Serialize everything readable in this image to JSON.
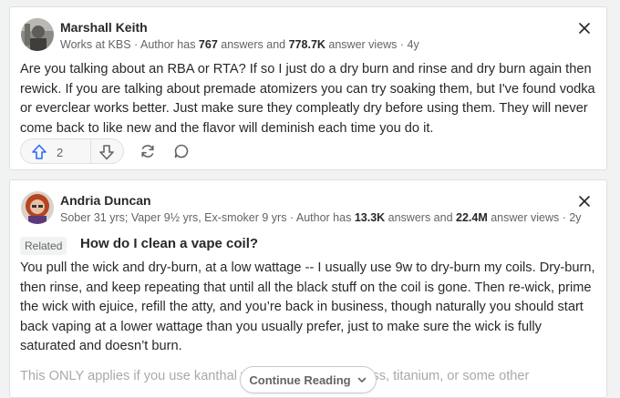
{
  "answer1": {
    "author": "Marshall Keith",
    "meta_prefix": "Works at KBS · Author has ",
    "answers_count": "767",
    "meta_mid": " answers and ",
    "views_count": "778.7K",
    "meta_suffix": " answer views · 4y",
    "body": "Are you talking about an RBA or RTA? If so I just do a dry burn and rinse and dry burn again then rewick. If you are talking about premade atomizers you can try soaking them, but I've found vodka or everclear works better. Just make sure they compleatly dry before using them. They will never come back to like new and the flavor will deminish each time you do it.",
    "upvotes": "2"
  },
  "answer2": {
    "author": "Andria Duncan",
    "meta_prefix": "Sober 31 yrs; Vaper 9½ yrs, Ex-smoker 9 yrs · Author has ",
    "answers_count": "13.3K",
    "meta_mid": " answers and ",
    "views_count": "22.4M",
    "meta_suffix": " answer views · 2y",
    "related_label": "Related",
    "related_question": "How do I clean a vape coil?",
    "body": "You pull the wick and dry-burn, at a low wattage -- I usually use 9w to dry-burn my coils. Dry-burn, then rinse, and keep repeating that until all the black stuff on the coil is gone. Then re-wick, prime the wick with ejuice, refill the atty, and you’re back in business, though naturally you should start back vaping at a lower wattage than you usually prefer, just to make sure the wick is fully saturated and doesn’t burn.",
    "faded_text": "This ONLY applies if you use kanthal wire. If you use stainless, titanium, or some other",
    "continue_label": "Continue Reading"
  },
  "colors": {
    "accent_blue": "#2e69ff",
    "icon_gray": "#636466",
    "background": "#f1f2f2"
  },
  "icons": [
    "avatar-photo",
    "close-icon",
    "upvote-arrow-icon",
    "downvote-arrow-icon",
    "share-icon",
    "comment-icon",
    "chevron-down-icon"
  ]
}
